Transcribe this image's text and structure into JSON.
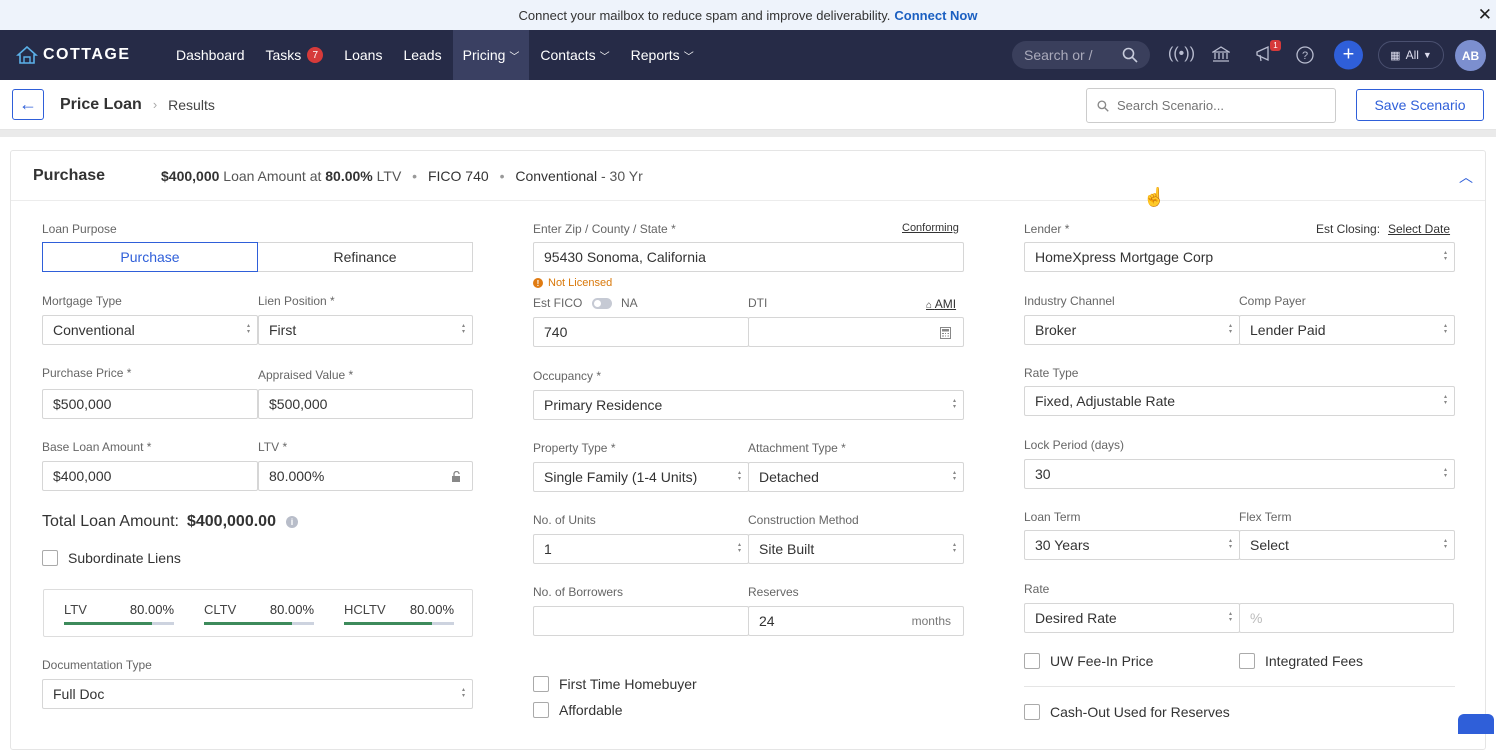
{
  "banner": {
    "text": "Connect your mailbox to reduce spam and improve deliverability.",
    "link": "Connect Now",
    "close": "✕"
  },
  "nav": {
    "brand": "COTTAGE",
    "items": [
      {
        "label": "Dashboard"
      },
      {
        "label": "Tasks",
        "badge": "7"
      },
      {
        "label": "Loans"
      },
      {
        "label": "Leads"
      },
      {
        "label": "Pricing",
        "active": true
      },
      {
        "label": "Contacts"
      },
      {
        "label": "Reports"
      }
    ],
    "search_placeholder": "Search or /",
    "notification_count": "1",
    "all_label": "All",
    "avatar_initials": "AB"
  },
  "subheader": {
    "back": "←",
    "crumb_root": "Price Loan",
    "crumb_current": "Results",
    "search_placeholder": "Search Scenario...",
    "save_label": "Save Scenario"
  },
  "card": {
    "title": "Purchase",
    "summary": {
      "loan_amount": "$400,000",
      "loan_amount_text": "Loan Amount at",
      "ltv_value": "80.00%",
      "ltv_text": "LTV",
      "fico": "FICO 740",
      "program": "Conventional",
      "term": "- 30 Yr"
    }
  },
  "form": {
    "loan_purpose": {
      "label": "Loan Purpose",
      "options": [
        "Purchase",
        "Refinance"
      ],
      "selected": "Purchase"
    },
    "mortgage_type": {
      "label": "Mortgage Type",
      "value": "Conventional"
    },
    "lien_position": {
      "label": "Lien Position *",
      "value": "First"
    },
    "purchase_price": {
      "label": "Purchase Price *",
      "value": "$500,000"
    },
    "appraised_value": {
      "label": "Appraised Value *",
      "value": "$500,000"
    },
    "base_loan_amount": {
      "label": "Base Loan Amount *",
      "value": "$400,000"
    },
    "ltv": {
      "label": "LTV *",
      "value": "80.000%"
    },
    "total_loan": {
      "label": "Total Loan Amount:",
      "value": "$400,000.00"
    },
    "subordinate_liens": "Subordinate Liens",
    "ratios": [
      {
        "label": "LTV",
        "value": "80.00%",
        "fill": 0.8
      },
      {
        "label": "CLTV",
        "value": "80.00%",
        "fill": 0.8
      },
      {
        "label": "HCLTV",
        "value": "80.00%",
        "fill": 0.8
      }
    ],
    "documentation_type": {
      "label": "Documentation Type",
      "value": "Full Doc"
    },
    "zip": {
      "label": "Enter Zip / County / State *",
      "value": "95430 Sonoma, California",
      "badge": "Conforming"
    },
    "not_licensed": "Not Licensed",
    "est_fico": {
      "label": "Est FICO",
      "na": "NA",
      "value": "740"
    },
    "dti": {
      "label": "DTI",
      "ami": "AMI",
      "value": ""
    },
    "occupancy": {
      "label": "Occupancy *",
      "value": "Primary Residence"
    },
    "property_type": {
      "label": "Property Type *",
      "value": "Single Family (1-4 Units)"
    },
    "attachment_type": {
      "label": "Attachment Type *",
      "value": "Detached"
    },
    "units": {
      "label": "No. of Units",
      "value": "1"
    },
    "construction": {
      "label": "Construction Method",
      "value": "Site Built"
    },
    "borrowers": {
      "label": "No. of Borrowers",
      "value": ""
    },
    "reserves": {
      "label": "Reserves",
      "value": "24",
      "unit": "months"
    },
    "first_time_homebuyer": "First Time Homebuyer",
    "affordable": "Affordable",
    "lender": {
      "label": "Lender *",
      "value": "HomeXpress Mortgage Corp"
    },
    "est_closing": {
      "label": "Est Closing:",
      "value": "Select Date"
    },
    "industry_channel": {
      "label": "Industry Channel",
      "value": "Broker"
    },
    "comp_payer": {
      "label": "Comp Payer",
      "value": "Lender Paid"
    },
    "rate_type": {
      "label": "Rate Type",
      "value": "Fixed, Adjustable Rate"
    },
    "lock_period": {
      "label": "Lock Period (days)",
      "value": "30"
    },
    "loan_term": {
      "label": "Loan Term",
      "value": "30 Years"
    },
    "flex_term": {
      "label": "Flex Term",
      "value": "Select"
    },
    "rate": {
      "label": "Rate",
      "value": "Desired Rate",
      "input_placeholder": "%"
    },
    "uw_fee": "UW Fee-In Price",
    "integrated_fees": "Integrated Fees",
    "cash_out": "Cash-Out Used for Reserves"
  }
}
